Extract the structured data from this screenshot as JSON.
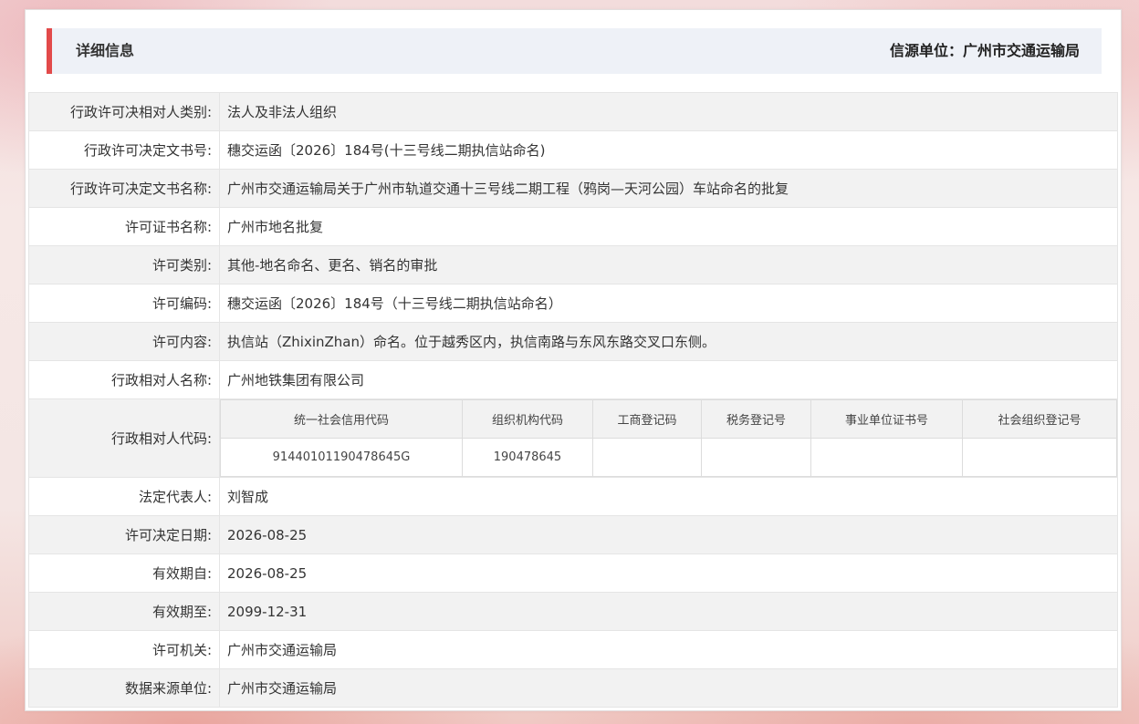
{
  "header": {
    "title": "详细信息",
    "source": "信源单位：广州市交通运输局"
  },
  "rows": [
    {
      "label": "行政许可决相对人类别:",
      "value": "法人及非法人组织"
    },
    {
      "label": "行政许可决定文书号:",
      "value": "穗交运函〔2026〕184号(十三号线二期执信站命名)"
    },
    {
      "label": "行政许可决定文书名称:",
      "value": "广州市交通运输局关于广州市轨道交通十三号线二期工程（鸦岗—天河公园）车站命名的批复"
    },
    {
      "label": "许可证书名称:",
      "value": "广州市地名批复"
    },
    {
      "label": "许可类别:",
      "value": "其他-地名命名、更名、销名的审批"
    },
    {
      "label": "许可编码:",
      "value": "穗交运函〔2026〕184号（十三号线二期执信站命名）"
    },
    {
      "label": "许可内容:",
      "value": "执信站（ZhixinZhan）命名。位于越秀区内，执信南路与东风东路交叉口东侧。"
    },
    {
      "label": "行政相对人名称:",
      "value": "广州地铁集团有限公司"
    }
  ],
  "code_row": {
    "label": "行政相对人代码:",
    "headers": [
      "统一社会信用代码",
      "组织机构代码",
      "工商登记码",
      "税务登记号",
      "事业单位证书号",
      "社会组织登记号"
    ],
    "values": [
      "91440101190478645G",
      "190478645",
      "",
      "",
      "",
      ""
    ]
  },
  "rows2": [
    {
      "label": "法定代表人:",
      "value": "刘智成"
    },
    {
      "label": "许可决定日期:",
      "value": "2026-08-25"
    },
    {
      "label": "有效期自:",
      "value": "2026-08-25"
    },
    {
      "label": "有效期至:",
      "value": "2099-12-31"
    },
    {
      "label": "许可机关:",
      "value": "广州市交通运输局"
    },
    {
      "label": "数据来源单位:",
      "value": "广州市交通运输局"
    }
  ]
}
